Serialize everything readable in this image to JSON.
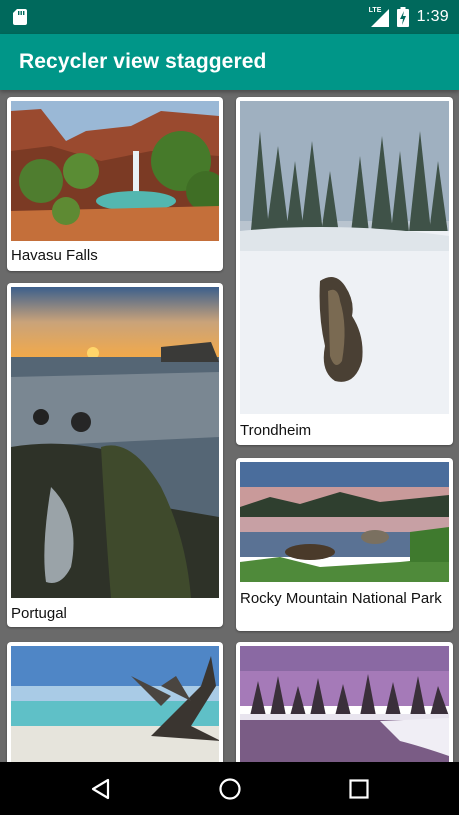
{
  "status_bar": {
    "time": "1:39",
    "network_label": "LTE",
    "icons": [
      "sd-card-icon",
      "lte-signal-icon",
      "battery-charging-icon"
    ]
  },
  "app_bar": {
    "title": "Recycler view staggered"
  },
  "colors": {
    "status_bar": "#00695c",
    "app_bar": "#009688",
    "list_background": "#6a6a6a",
    "card": "#ffffff"
  },
  "cards": [
    {
      "title": "Havasu Falls"
    },
    {
      "title": "Trondheim"
    },
    {
      "title": "Portugal"
    },
    {
      "title": "Rocky Mountain National Park"
    },
    {
      "title": ""
    },
    {
      "title": ""
    }
  ],
  "nav_bar": {
    "icons": [
      "back-icon",
      "home-icon",
      "recents-icon"
    ]
  }
}
